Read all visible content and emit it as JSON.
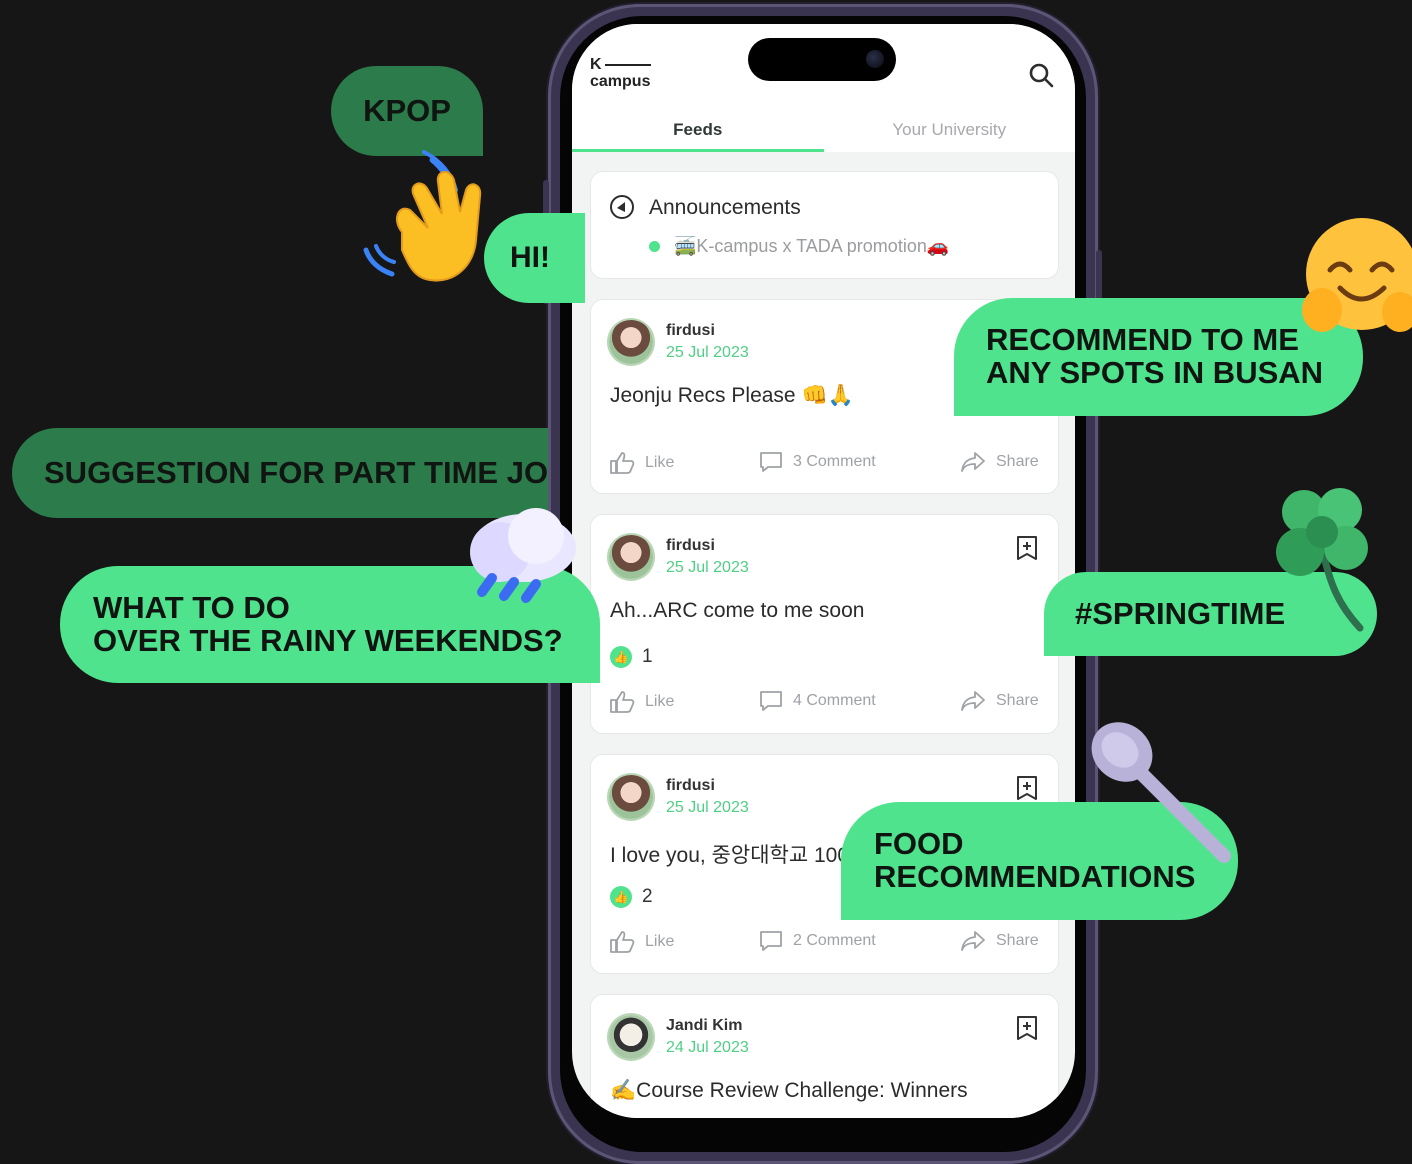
{
  "app": {
    "logo_line1": "K",
    "logo_line2": "campus",
    "tabs": [
      "Feeds",
      "Your University"
    ]
  },
  "announcements": {
    "title": "Announcements",
    "item": "🚎K-campus x TADA promotion🚗"
  },
  "posts": [
    {
      "user": "firdusi",
      "date": "25 Jul 2023",
      "text": "Jeonju Recs Please 👊🙏",
      "likes": "",
      "comments": "3 Comment",
      "bookmark": false
    },
    {
      "user": "firdusi",
      "date": "25 Jul 2023",
      "text": "Ah...ARC come to me soon",
      "likes": "1",
      "comments": "4 Comment",
      "bookmark": true
    },
    {
      "user": "firdusi",
      "date": "25 Jul 2023",
      "text": "I love you, 중앙대학교 100",
      "likes": "2",
      "comments": "2 Comment",
      "bookmark": true
    },
    {
      "user": "Jandi Kim",
      "date": "24 Jul 2023",
      "text": "✍️Course Review Challenge: Winners",
      "likes": "",
      "comments": "",
      "bookmark": true
    }
  ],
  "actions": {
    "like": "Like",
    "share": "Share"
  },
  "bubbles": {
    "kpop": "KPOP",
    "hi": "HI!",
    "part_time": "SUGGESTION FOR PART TIME JO",
    "rainy_1": "WHAT TO DO",
    "rainy_2": "OVER THE RAINY WEEKENDS?",
    "busan_1": "RECOMMEND TO ME",
    "busan_2": "ANY SPOTS IN BUSAN",
    "spring": "#SPRINGTIME",
    "food_1": "FOOD",
    "food_2": "RECOMMENDATIONS"
  },
  "colors": {
    "accent": "#4fe38d",
    "dark_green": "#2b7b4b",
    "background": "#161616"
  }
}
